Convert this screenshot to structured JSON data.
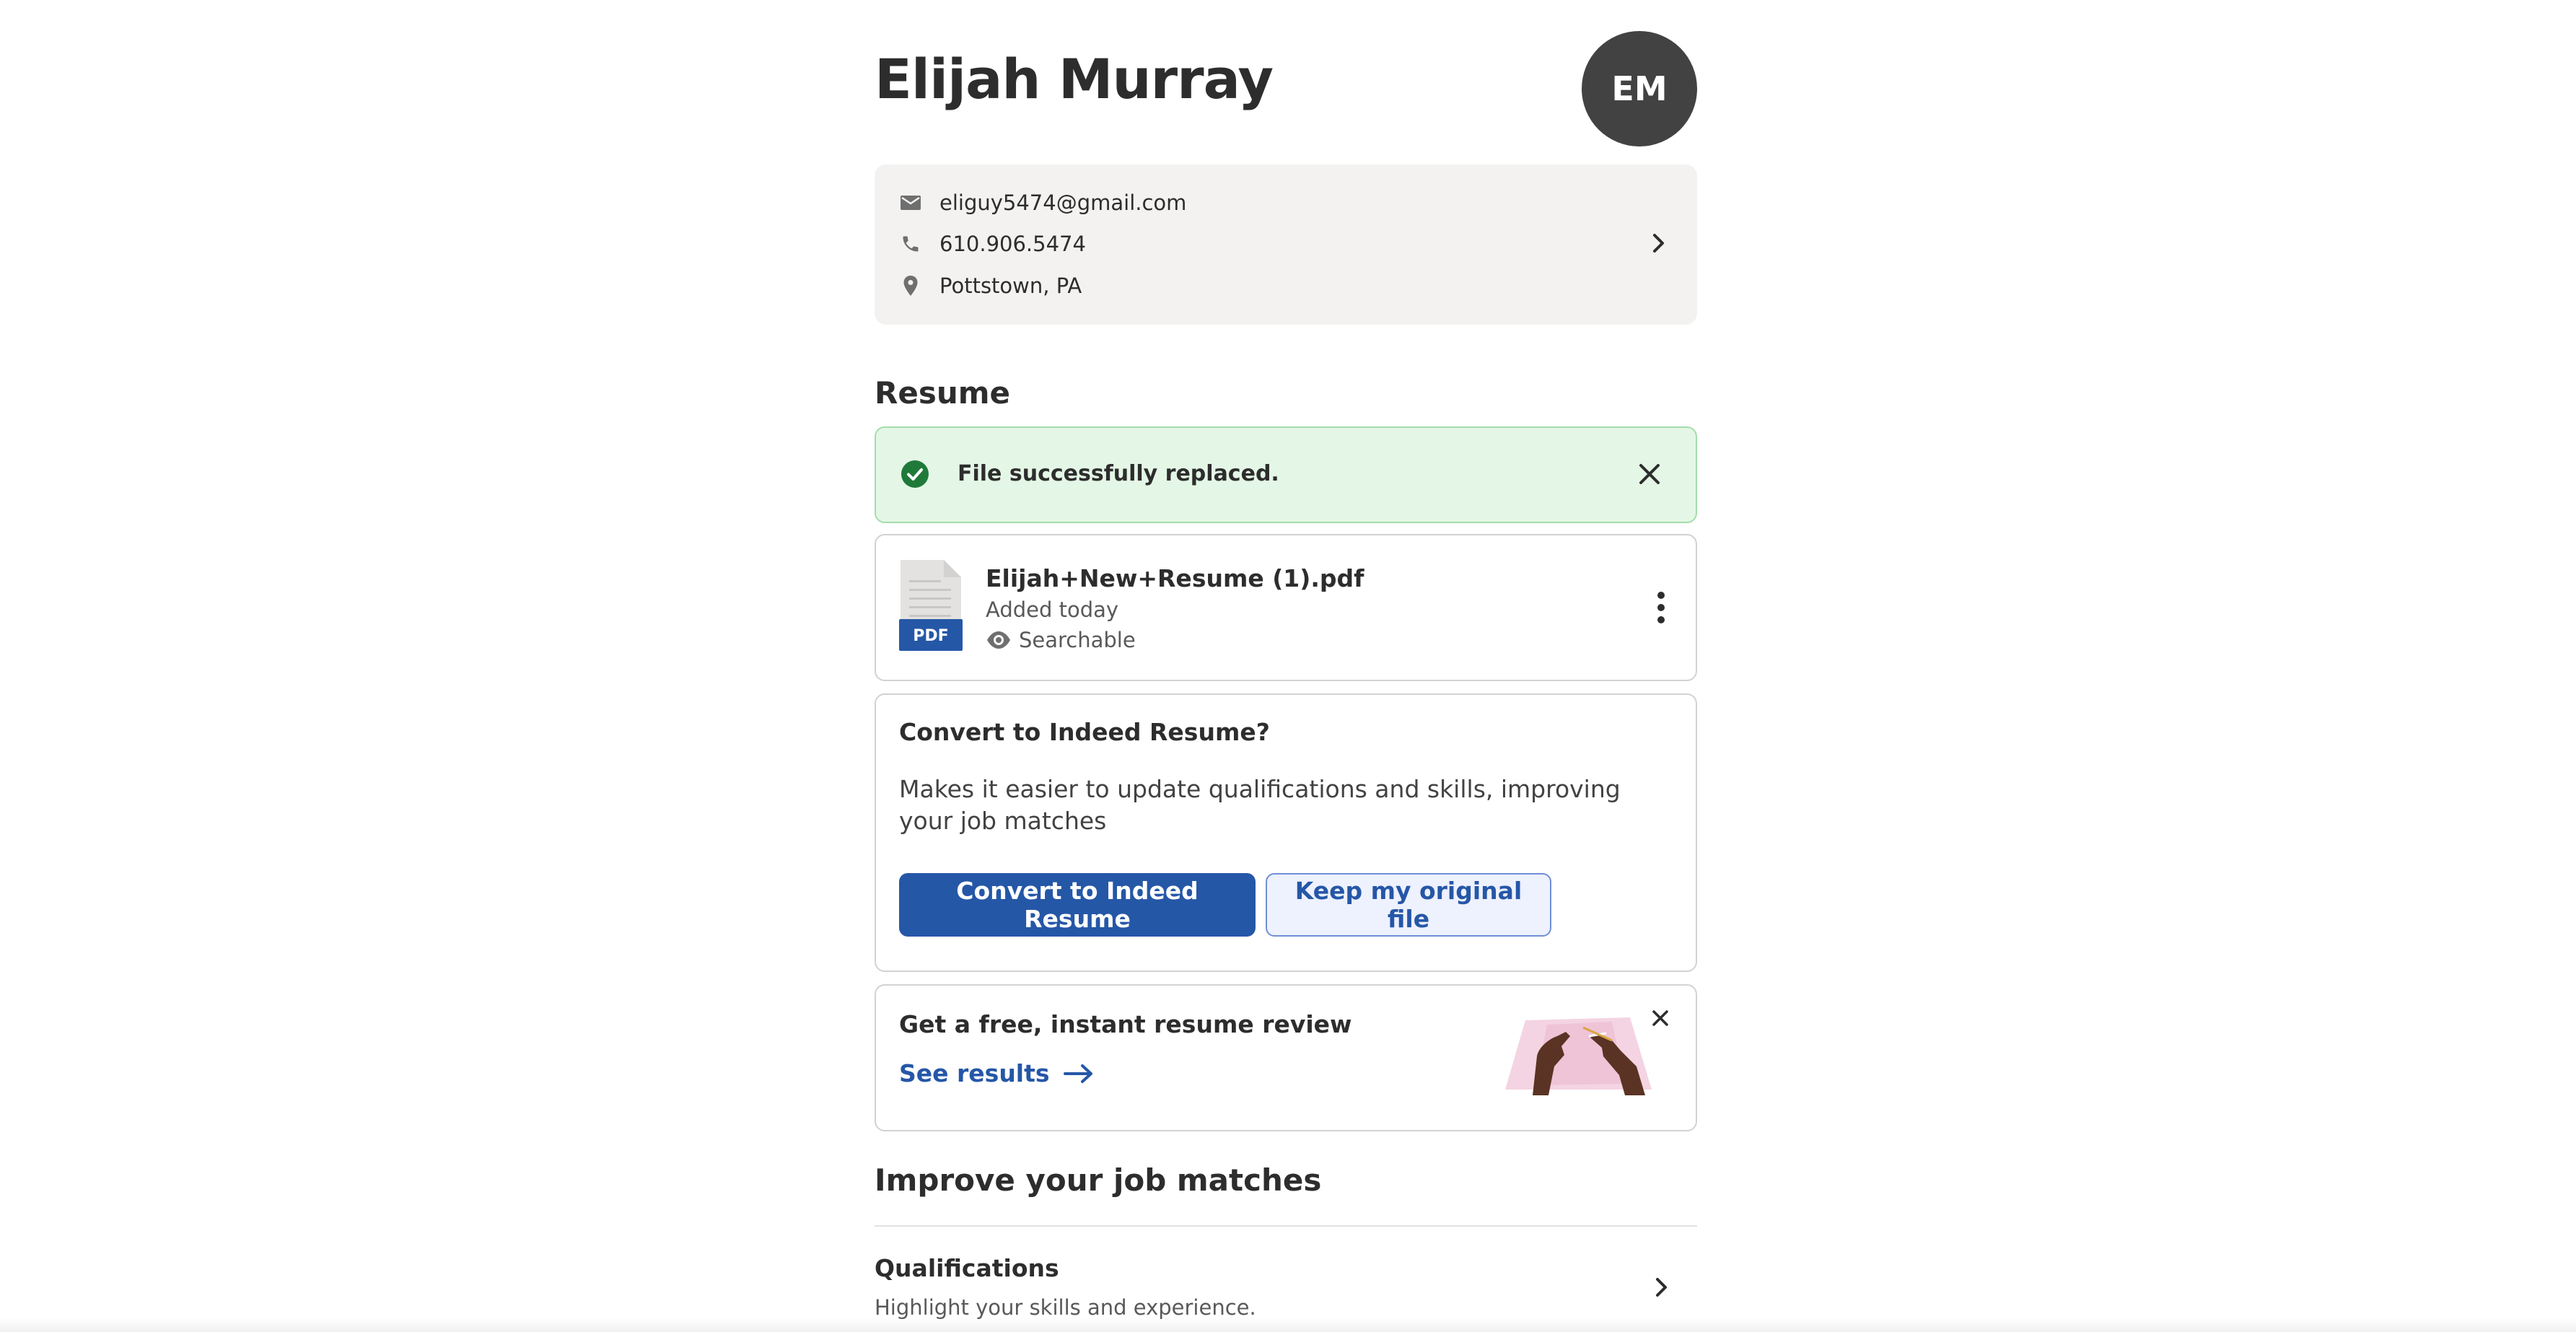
{
  "profile": {
    "name": "Elijah Murray",
    "initials": "EM"
  },
  "contact": {
    "email": "eliguy5474@gmail.com",
    "phone": "610.906.5474",
    "location": "Pottstown, PA"
  },
  "resume": {
    "section_title": "Resume",
    "banner_text": "File successfully replaced.",
    "file": {
      "name": "Elijah+New+Resume (1).pdf",
      "type_badge": "PDF",
      "added": "Added today",
      "visibility": "Searchable"
    },
    "convert": {
      "title": "Convert to Indeed Resume?",
      "description": "Makes it easier to update qualifications and skills, improving your job matches",
      "primary_label": "Convert to Indeed Resume",
      "secondary_label": "Keep my original file"
    },
    "review": {
      "title": "Get a free, instant resume review",
      "link_label": "See results"
    }
  },
  "improve": {
    "section_title": "Improve your job matches",
    "qualifications_title": "Qualifications",
    "qualifications_sub": "Highlight your skills and experience."
  },
  "colors": {
    "accent": "#2557a7",
    "success_bg": "#e4f7e6",
    "success_icon": "#1f7a3a",
    "card_bg": "#f3f2f1",
    "avatar_bg": "#424242"
  },
  "icons": {
    "email": "mail-icon",
    "phone": "phone-icon",
    "location": "location-pin-icon",
    "success": "check-circle-icon",
    "close": "close-icon",
    "visibility": "eye-icon",
    "more": "kebab-menu-icon",
    "arrow": "arrow-right-icon",
    "chevron": "chevron-right-icon"
  }
}
